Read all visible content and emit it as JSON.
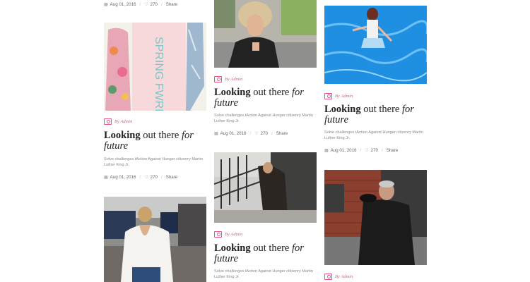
{
  "cards": {
    "c1_top": {
      "date": "Aug 01, 2016",
      "likes": "270",
      "share": "Share"
    },
    "c1": {
      "author": "By Admin",
      "title_bold": "Looking",
      "title_mid": " out there ",
      "title_ital1": "for",
      "title_ital2": "future",
      "excerpt": "Solve challenges tAction Against Hunger citizenry Martin Luther King Jr.",
      "date": "Aug 01, 2016",
      "likes": "270",
      "share": "Share",
      "img_text": "SPRING FWRD"
    },
    "c2": {
      "author": "By Admin",
      "title_bold": "Looking",
      "title_mid": " out there ",
      "title_ital1": "for",
      "title_ital2": "future",
      "excerpt": "Solve challenges tAction Against Hunger citizenry Martin Luther King Jr.",
      "date": "Aug 01, 2016",
      "likes": "270",
      "share": "Share"
    },
    "c3": {
      "author": "By Admin",
      "title_bold": "Looking",
      "title_mid": " out there ",
      "title_ital1": "for",
      "title_ital2": "future",
      "excerpt": "Solve challenges tAction Against Hunger citizenry Martin Luther King Jr."
    },
    "c4": {
      "author": "By Admin",
      "title_bold": "Looking",
      "title_mid": " out there ",
      "title_ital1": "for",
      "title_ital2": "future",
      "excerpt": "Solve challenges tAction Against Hunger citizenry Martin Luther King Jr.",
      "date": "Aug 01, 2016",
      "likes": "270",
      "share": "Share"
    },
    "c5": {
      "author": "By Admin"
    }
  },
  "colors": {
    "accent": "#e0558f"
  },
  "icons": {
    "author": "camera-icon",
    "date": "calendar-icon",
    "likes": "heart-icon"
  }
}
